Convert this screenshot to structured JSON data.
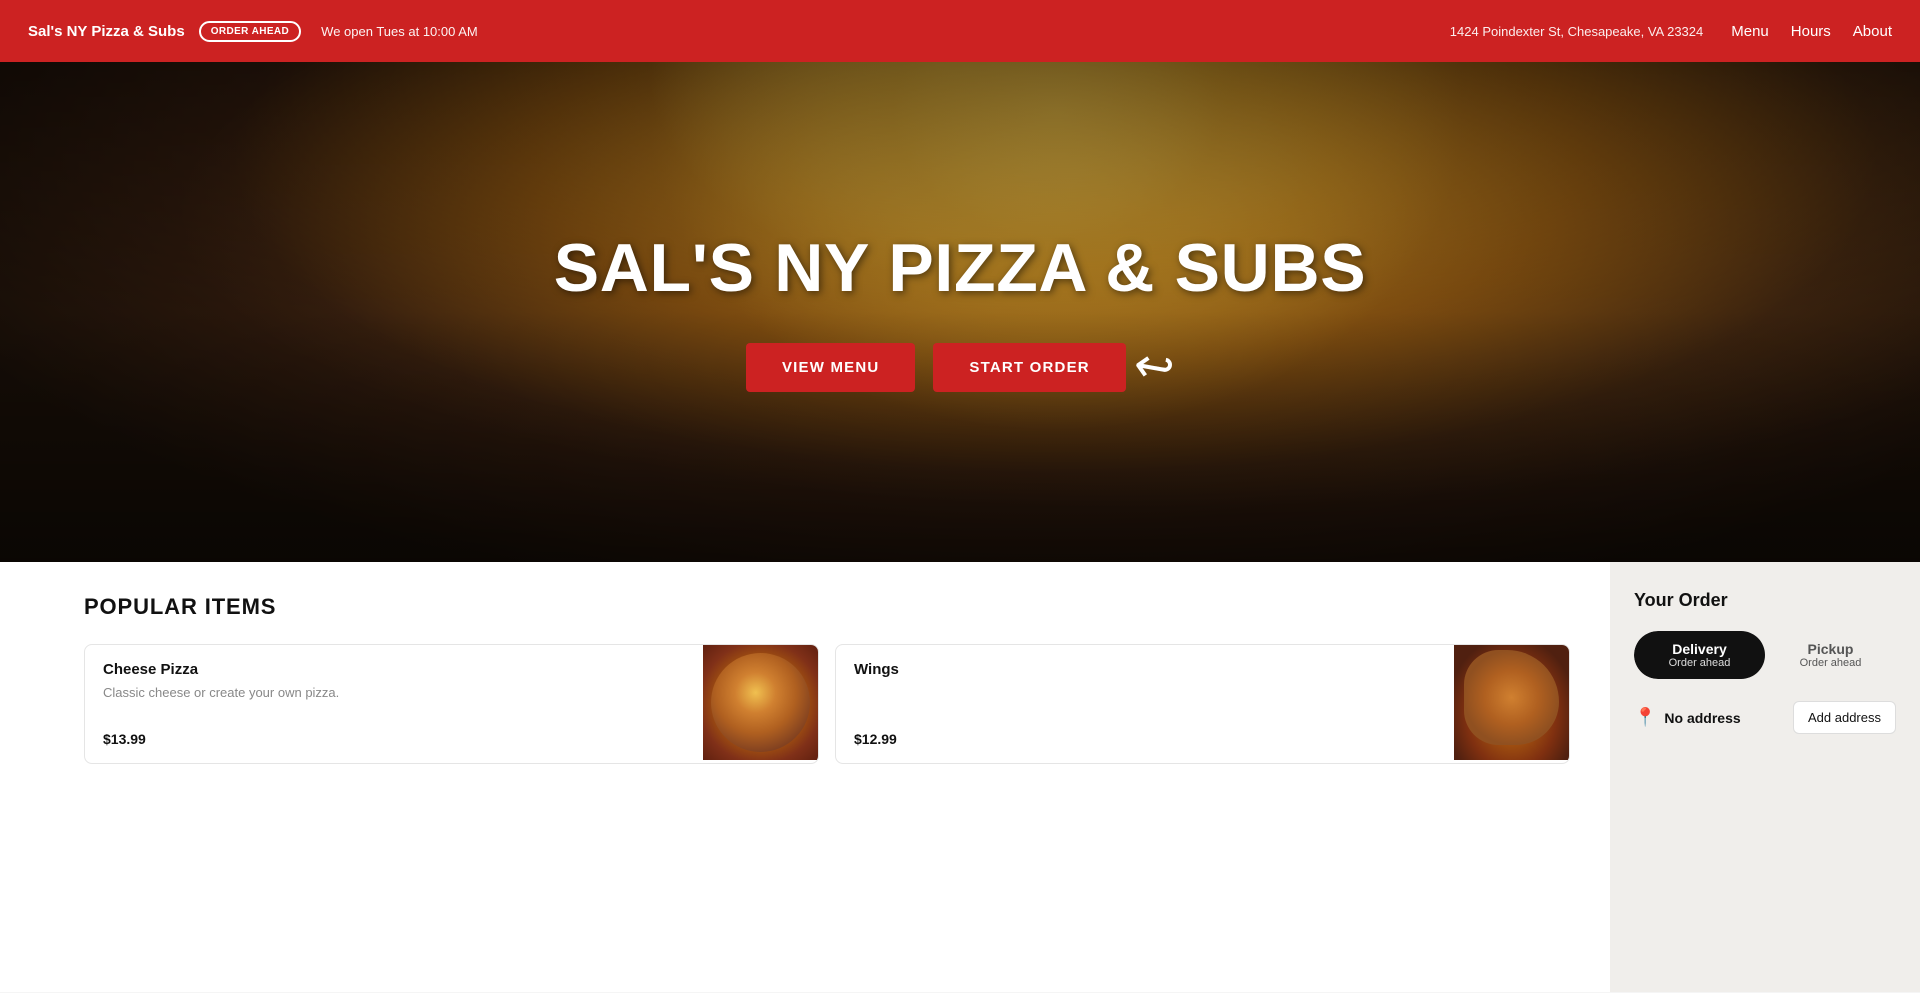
{
  "header": {
    "brand": "Sal's NY Pizza & Subs",
    "badge": "OrDeR Ahead",
    "hours": "We open Tues at 10:00 AM",
    "address": "1424 Poindexter St, Chesapeake, VA 23324",
    "nav": {
      "menu": "Menu",
      "hours": "Hours",
      "about": "About"
    }
  },
  "hero": {
    "title": "SAL'S NY PIZZA & SUBS",
    "view_menu_btn": "VIEW MENU",
    "start_order_btn": "START ORDER"
  },
  "popular_items": {
    "section_title": "POPULAR ITEMS",
    "items": [
      {
        "name": "Cheese Pizza",
        "description": "Classic cheese or create your own pizza.",
        "price": "$13.99",
        "image_type": "pizza"
      },
      {
        "name": "Wings",
        "description": "",
        "price": "$12.99",
        "image_type": "wings"
      }
    ]
  },
  "order_panel": {
    "title": "Your Order",
    "delivery_label": "Delivery",
    "delivery_sub": "Order ahead",
    "pickup_label": "Pickup",
    "pickup_sub": "Order ahead",
    "no_address": "No address",
    "add_address_btn": "Add address"
  }
}
